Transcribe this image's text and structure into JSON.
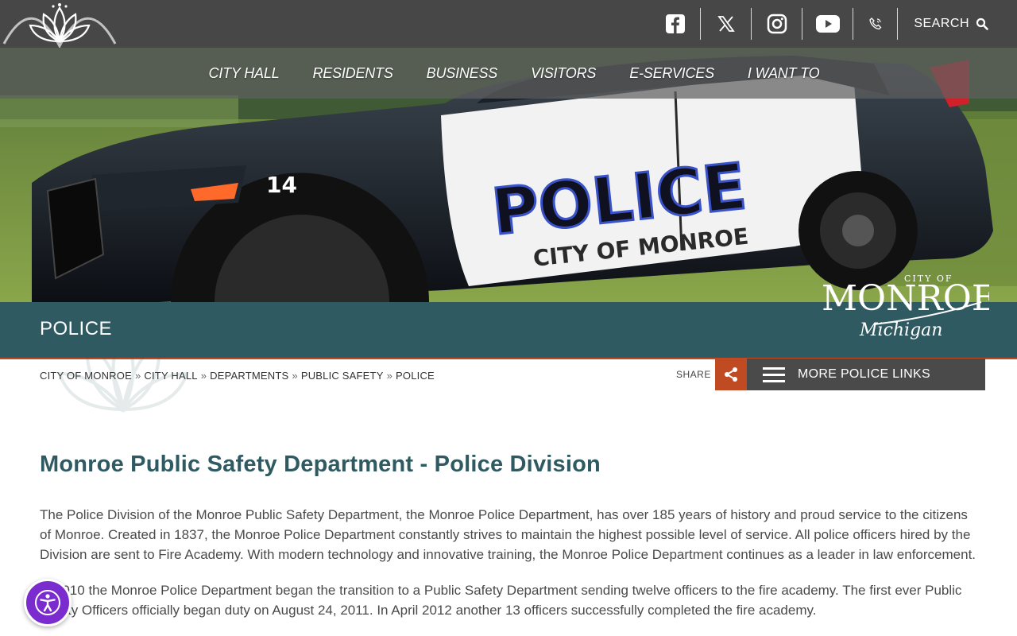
{
  "social": {
    "icons": [
      "facebook-icon",
      "x-twitter-icon",
      "instagram-icon",
      "youtube-icon",
      "phone-icon"
    ],
    "search_label": "SEARCH"
  },
  "nav": {
    "items": [
      "CITY HALL",
      "RESIDENTS",
      "BUSINESS",
      "VISITORS",
      "E-SERVICES",
      "I WANT TO"
    ]
  },
  "hero": {
    "car_number": "14",
    "door_text_big": "POLICE",
    "door_text_small": "CITY OF MONROE"
  },
  "logo": {
    "city_of": "CITY OF",
    "name": "MONROE",
    "state": "Michigan"
  },
  "page": {
    "title": "POLICE"
  },
  "breadcrumb": {
    "items": [
      "CITY OF MONROE",
      "CITY HALL",
      "DEPARTMENTS",
      "PUBLIC SAFETY",
      "POLICE"
    ],
    "separator": "»"
  },
  "share": {
    "label": "SHARE"
  },
  "more_links": {
    "label": "MORE POLICE LINKS"
  },
  "content": {
    "heading": "Monroe Public Safety Department - Police Division",
    "paragraphs": [
      "The Police Division of the Monroe Public Safety Department, the Monroe Police Department, has over 185 years of history and proud service to the citizens of Monroe. Created in 1837, the Monroe Police Department constantly strives to maintain the highest possible level of service. All police officers hired by the Division are sent to Fire Academy.  With modern technology and innovative training, the Monroe Police Department continues as a leader in law enforcement.",
      "In 2010 the Monroe Police Department began the transition to a Public Safety Department sending twelve officers to the fire academy.  The first ever Public Safety Officers officially began duty on August 24, 2011. In April 2012 another 13 officers successfully completed the fire academy."
    ]
  },
  "colors": {
    "topbar": "#474747",
    "title_band": "#2f5a61",
    "accent": "#c04a22",
    "heading": "#2f5a61",
    "accessibility": "#7b2ccf"
  }
}
